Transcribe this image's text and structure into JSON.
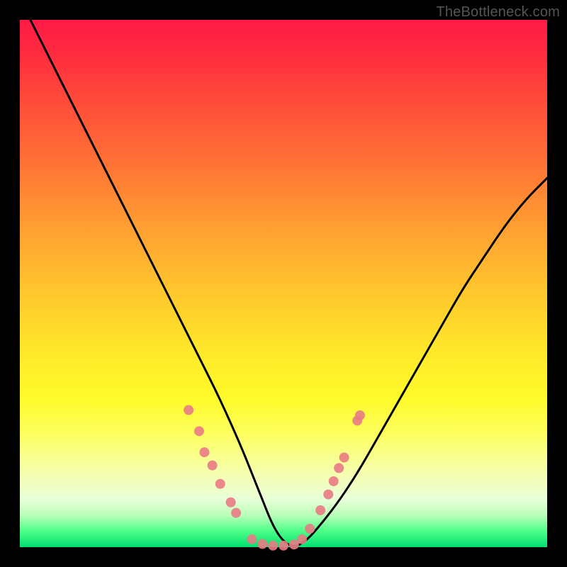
{
  "watermark": "TheBottleneck.com",
  "chart_data": {
    "type": "line",
    "title": "",
    "xlabel": "",
    "ylabel": "",
    "xlim": [
      0,
      100
    ],
    "ylim": [
      0,
      100
    ],
    "grid": false,
    "legend": false,
    "series": [
      {
        "name": "bottleneck-curve",
        "color": "#000000",
        "x": [
          2,
          6,
          10,
          14,
          18,
          22,
          26,
          30,
          34,
          38,
          42,
          44,
          46,
          48,
          50,
          52,
          54,
          56,
          60,
          64,
          68,
          72,
          76,
          80,
          84,
          88,
          92,
          96,
          100
        ],
        "y": [
          100,
          92,
          84,
          76,
          68,
          60,
          52,
          44,
          36,
          28,
          19,
          14,
          9,
          4,
          1,
          0,
          1,
          3,
          8,
          14,
          21,
          28,
          35,
          42,
          49,
          55,
          61,
          66,
          70
        ]
      }
    ],
    "markers": {
      "name": "highlight-points",
      "color": "#e97b84",
      "radius_px": 7,
      "points": [
        {
          "x": 32,
          "y": 26
        },
        {
          "x": 34,
          "y": 22
        },
        {
          "x": 35,
          "y": 18
        },
        {
          "x": 36.5,
          "y": 15.5
        },
        {
          "x": 38,
          "y": 12
        },
        {
          "x": 40,
          "y": 8.5
        },
        {
          "x": 41,
          "y": 6.5
        },
        {
          "x": 44,
          "y": 1.5
        },
        {
          "x": 46,
          "y": 0.6
        },
        {
          "x": 48,
          "y": 0.3
        },
        {
          "x": 50,
          "y": 0.3
        },
        {
          "x": 52,
          "y": 0.5
        },
        {
          "x": 53.5,
          "y": 1.5
        },
        {
          "x": 55,
          "y": 3.5
        },
        {
          "x": 57,
          "y": 7
        },
        {
          "x": 58.5,
          "y": 10
        },
        {
          "x": 59.5,
          "y": 12.5
        },
        {
          "x": 60.5,
          "y": 15
        },
        {
          "x": 61.5,
          "y": 17
        },
        {
          "x": 64,
          "y": 24
        },
        {
          "x": 64.5,
          "y": 25
        }
      ]
    },
    "background_gradient": {
      "top": "#ff1a47",
      "mid": "#ffe22c",
      "bottom": "#00e070"
    }
  }
}
